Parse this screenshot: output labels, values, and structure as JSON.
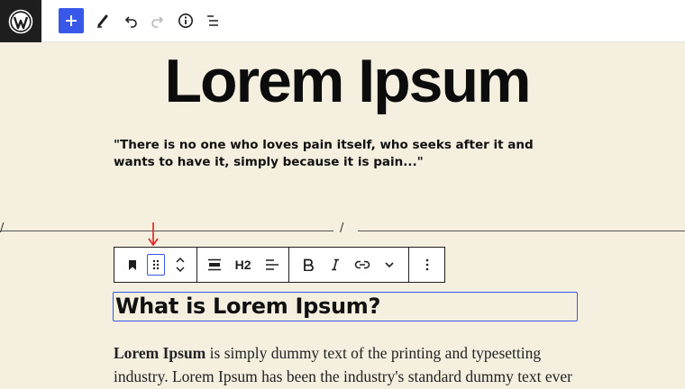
{
  "topbar": {
    "logo": "wordpress-logo",
    "buttons": [
      "add-block",
      "tools-pencil",
      "undo",
      "redo",
      "details-info",
      "list-view"
    ]
  },
  "content": {
    "title": "Lorem Ipsum",
    "quote": "\"There is no one who loves pain itself, who seeks after it and wants to have it, simply because it is pain...\"",
    "separator_slash_left": "/",
    "separator_slash_right": "/",
    "heading": "What is Lorem Ipsum?",
    "paragraph_bold": "Lorem Ipsum",
    "paragraph_line1_rest": " is simply dummy text of the printing and typesetting",
    "paragraph_line2": "industry. Lorem Ipsum has been the industry's standard dummy text ever"
  },
  "block_toolbar": {
    "heading_level": "H2"
  },
  "colors": {
    "accent": "#3858e9",
    "page_bg": "#f5efdf",
    "annotation_arrow": "#e02020"
  }
}
